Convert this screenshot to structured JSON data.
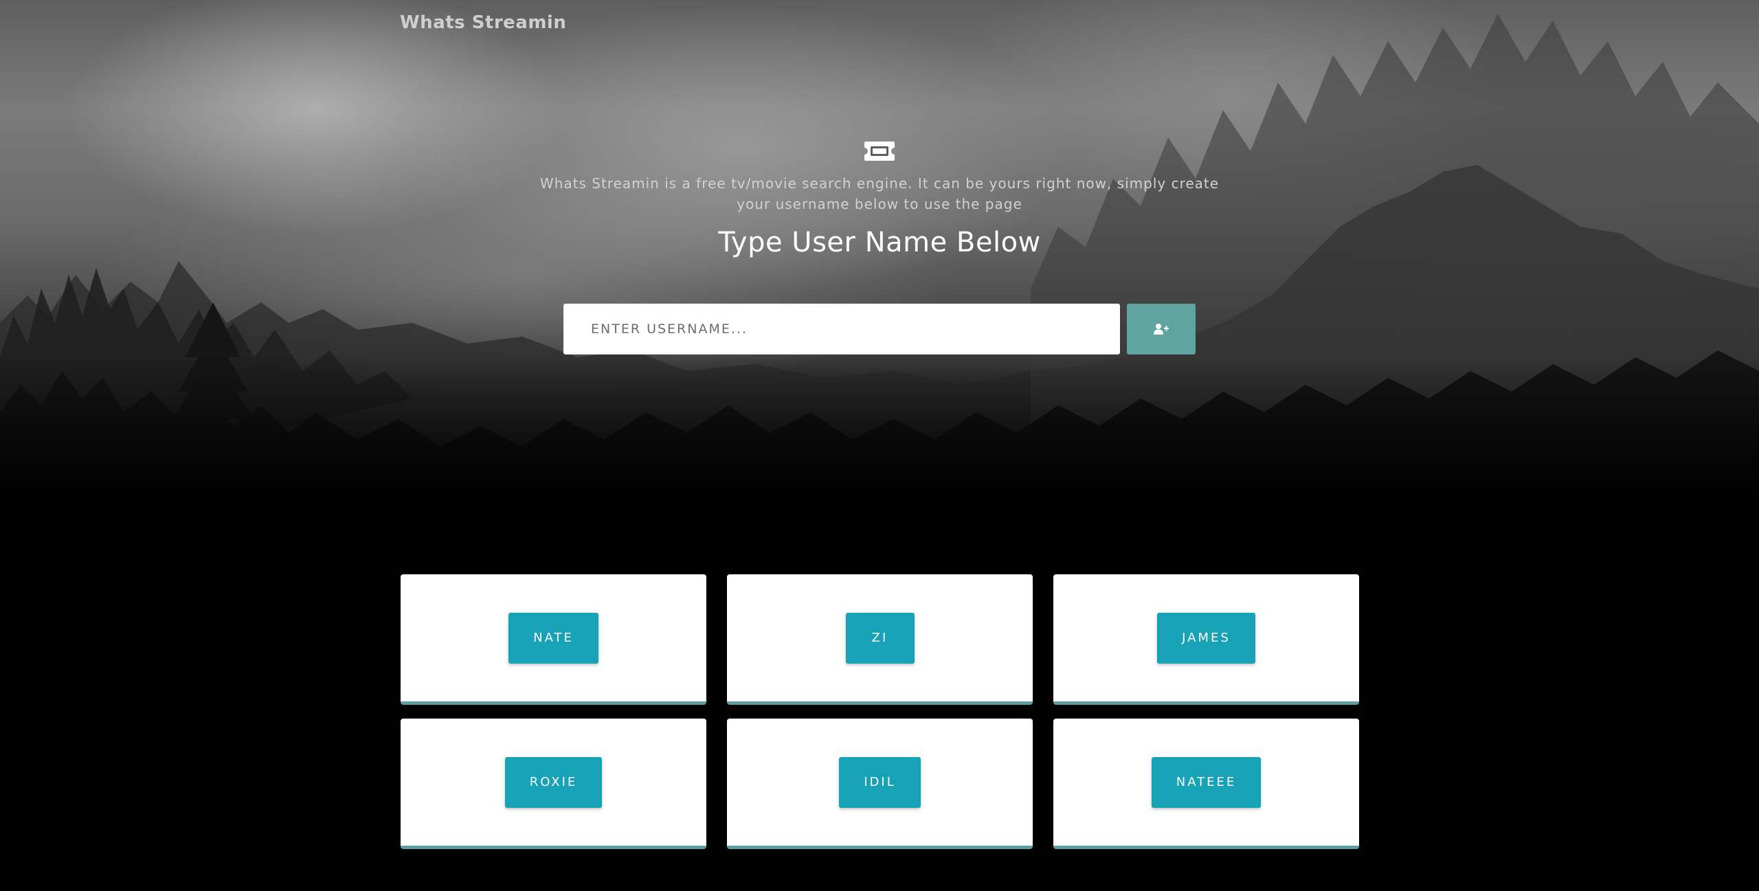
{
  "header": {
    "brand": "Whats Streamin"
  },
  "hero": {
    "icon": "ticket-icon",
    "description": "Whats Streamin is a free tv/movie search engine. It can be yours right now, simply create your username below to use the page",
    "headline": "Type User Name Below",
    "input": {
      "placeholder": "ENTER USERNAME...",
      "value": ""
    },
    "submit_icon": "user-plus-icon"
  },
  "users": [
    {
      "name": "NATE"
    },
    {
      "name": "ZI"
    },
    {
      "name": "JAMES"
    },
    {
      "name": "ROXIE"
    },
    {
      "name": "IDIL"
    },
    {
      "name": "NATEEE"
    }
  ],
  "colors": {
    "accent": "#17a2b8",
    "submit_button": "#5fa4a1",
    "card_border": "#5e9ea3",
    "background": "#000000"
  }
}
